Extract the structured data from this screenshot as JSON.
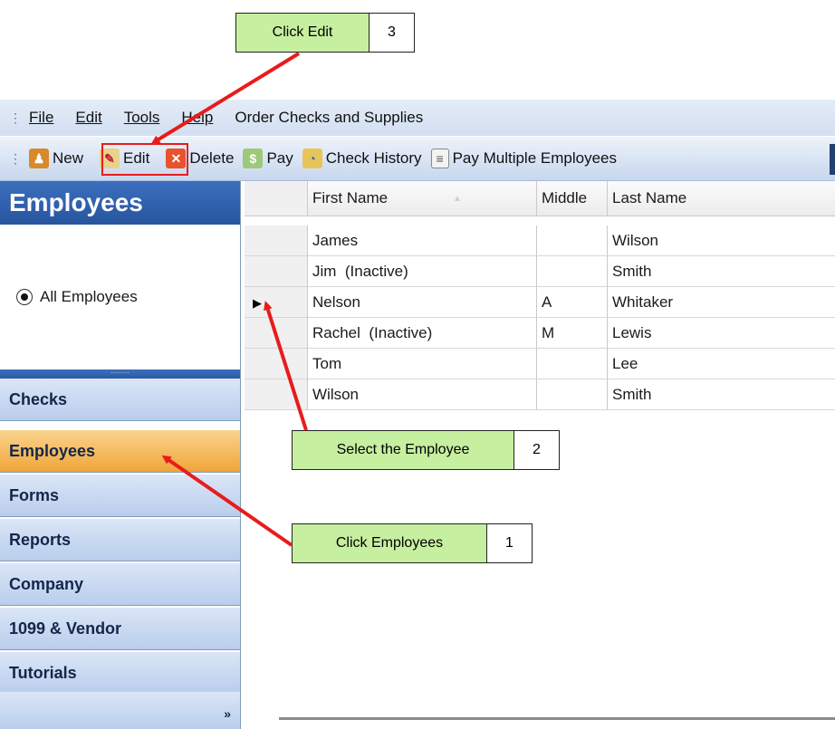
{
  "colors": {
    "callout_fill": "#c6efa0",
    "arrow": "#e81c1c",
    "sidebar_header": "#2e5ea9",
    "nav_active": "#f3b248",
    "nav_default": "#c7d8f1",
    "toolbar": "#d6e2f3"
  },
  "callouts": [
    {
      "text": "Click Edit",
      "number": "3"
    },
    {
      "text": "Select the Employee",
      "number": "2"
    },
    {
      "text": "Click Employees",
      "number": "1"
    }
  ],
  "menubar": {
    "items": [
      "File",
      "Edit",
      "Tools",
      "Help",
      "Order Checks and Supplies"
    ],
    "mnemonic_underlined": [
      true,
      true,
      true,
      true,
      false
    ]
  },
  "toolbar": {
    "buttons": [
      {
        "label": "New",
        "icon": "people-icon"
      },
      {
        "label": "Edit",
        "icon": "edit-card-icon"
      },
      {
        "label": "Delete",
        "icon": "delete-x-icon"
      },
      {
        "label": "Pay",
        "icon": "pay-icon"
      },
      {
        "label": "Check History",
        "icon": "check-history-icon"
      },
      {
        "label": "Pay Multiple Employees",
        "icon": "pay-multiple-icon"
      }
    ]
  },
  "sidebar": {
    "title": "Employees",
    "filter_option": "All Employees",
    "nav_items": [
      "Checks",
      "Employees",
      "Forms",
      "Reports",
      "Company",
      "1099 & Vendor",
      "Tutorials"
    ],
    "active_nav": "Employees",
    "overflow_glyph": "»"
  },
  "grid": {
    "columns": [
      "First Name",
      "Middle",
      "Last Name"
    ],
    "rows": [
      {
        "first": "James",
        "middle": "",
        "last": "Wilson"
      },
      {
        "first": "Jim  (Inactive)",
        "middle": "",
        "last": "Smith"
      },
      {
        "first": "Nelson",
        "middle": "A",
        "last": "Whitaker"
      },
      {
        "first": "Rachel  (Inactive)",
        "middle": "M",
        "last": "Lewis"
      },
      {
        "first": "Tom",
        "middle": "",
        "last": "Lee"
      },
      {
        "first": "Wilson",
        "middle": "",
        "last": "Smith"
      }
    ],
    "current_row": "Nelson"
  }
}
